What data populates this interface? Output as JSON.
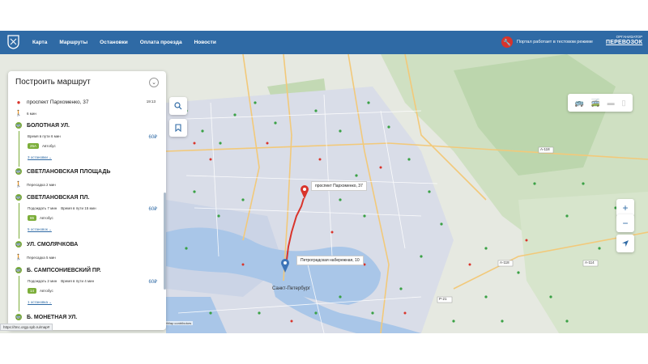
{
  "header": {
    "nav": [
      "Карта",
      "Маршруты",
      "Остановки",
      "Оплата проезда",
      "Новости"
    ],
    "status_text": "Портал работает в тестовом режиме",
    "brand_top": "ОРГАНИЗАТОР",
    "brand_main": "ПЕРЕВОЗОК",
    "logo_icon": "coat-of-arms-icon",
    "status_icon": "wrench-icon",
    "accent": "#2f6aa5",
    "alert": "#d9342b"
  },
  "panel": {
    "title": "Построить маршрут",
    "origin": {
      "label": "проспект Пархоменко, 37",
      "time": "19:13"
    },
    "first_walk": "6 мин",
    "stops": [
      {
        "name": "БОЛОТНАЯ УЛ.",
        "details": "Время в пути 6 мин",
        "route": "25А",
        "mode": "Автобус",
        "price": "60₽",
        "count": "3 остановки ⌄"
      },
      {
        "name": "СВЕТЛАНОВСКАЯ ПЛОЩАДЬ",
        "transfer": "Пересадка 2 мин"
      },
      {
        "name": "СВЕТЛАНОВСКАЯ ПЛ.",
        "wait": "Подождать 7 мин",
        "details": "Время в пути 15 мин",
        "route": "86",
        "mode": "Автобус",
        "price": "60₽",
        "count": "5 остановок ⌄"
      },
      {
        "name": "УЛ. СМОЛЯЧКОВА",
        "transfer": "Пересадка 5 мин"
      },
      {
        "name": "Б. САМПСОНИЕВСКИЙ ПР.",
        "wait": "Подождать 2 мин",
        "details": "Время в пути 4 мин",
        "route": "14",
        "mode": "Автобус",
        "price": "60₽",
        "count": "1 остановка ⌄"
      },
      {
        "name": "Б. МОНЕТНАЯ УЛ."
      }
    ]
  },
  "map": {
    "tooltip_origin": "проспект Пархоменко, 37",
    "tooltip_destination": "Петроградская набережная, 10",
    "city_label": "Санкт-Петербург",
    "road_labels": [
      "А-118",
      "А-118",
      "А-114",
      "Р-21"
    ],
    "url": "https://tmc.orgp.spb.ru/map#",
    "copyright": "© OpenStreetMap contributors"
  },
  "controls": {
    "search_icon": "search-icon",
    "bookmark_icon": "bookmark-icon",
    "zoom_in": "+",
    "zoom_out": "−",
    "locate_icon": "locate-arrow-icon",
    "transport_icons": [
      "bus-icon",
      "trolleybus-icon",
      "tram-icon",
      "metro-icon"
    ]
  }
}
